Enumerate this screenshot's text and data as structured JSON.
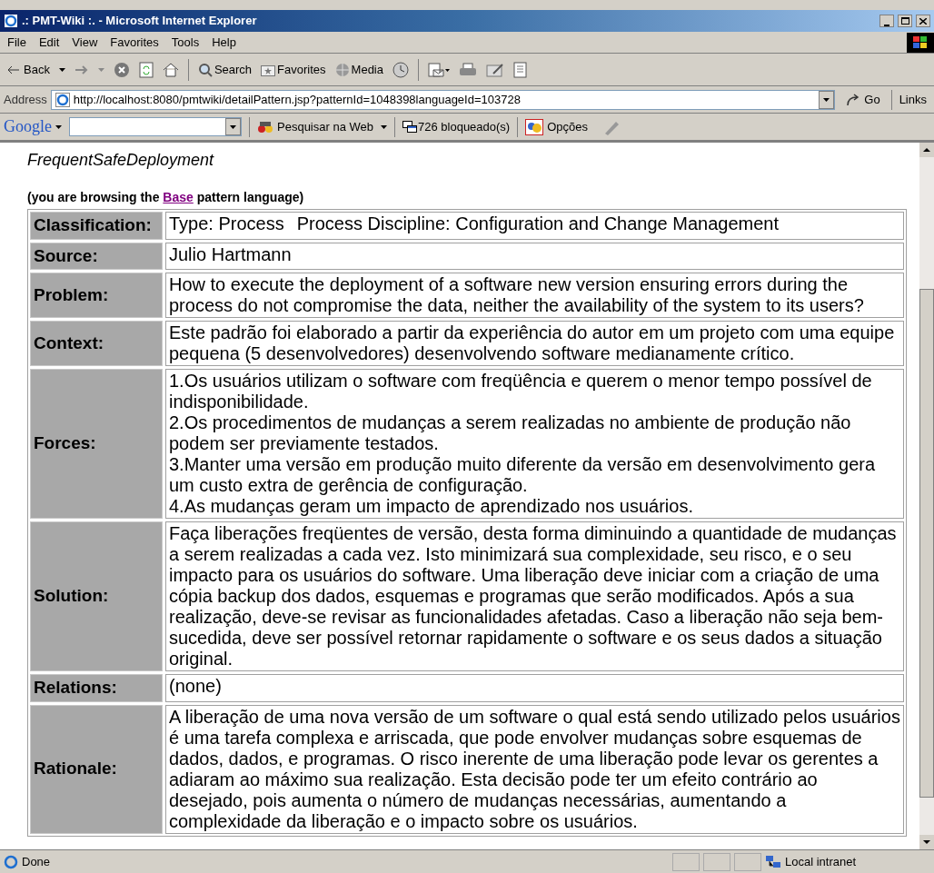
{
  "window": {
    "title": ".: PMT-Wiki :. - Microsoft Internet Explorer"
  },
  "menu": [
    "File",
    "Edit",
    "View",
    "Favorites",
    "Tools",
    "Help"
  ],
  "toolbar": {
    "back": "Back",
    "search": "Search",
    "favorites": "Favorites",
    "media": "Media"
  },
  "address_bar": {
    "label": "Address",
    "url": "http://localhost:8080/pmtwiki/detailPattern.jsp?patternId=1048398languageId=103728",
    "go": "Go",
    "links": "Links"
  },
  "google_bar": {
    "logo": "Google",
    "search_web": "Pesquisar na Web",
    "blocked": "726 bloqueado(s)",
    "options": "Opções"
  },
  "page": {
    "title": "FrequentSafeDeployment",
    "note": {
      "before": "(you are browsing the ",
      "link": "Base",
      "after": " pattern language)"
    },
    "rows": [
      {
        "label": "Classification:",
        "parts": [
          "Type: Process",
          "Process Discipline: Configuration and Change Management"
        ]
      },
      {
        "label": "Source:",
        "parts": [
          "Julio Hartmann"
        ]
      },
      {
        "label": "Problem:",
        "paragraphs": [
          "How to execute the deployment of a software new version ensuring errors during the process do not compromise the data, neither the availability of the system to its users?"
        ]
      },
      {
        "label": "Context:",
        "paragraphs": [
          "Este padrão foi elaborado a partir da experiência do autor em um projeto com uma equipe pequena (5 desenvolvedores) desenvolvendo software medianamente crítico."
        ]
      },
      {
        "label": "Forces:",
        "paragraphs": [
          "1.Os usuários utilizam o software com freqüência e querem o menor tempo possível de indisponibilidade.",
          "2.Os procedimentos de mudanças a serem realizadas no ambiente de produção não podem ser previamente testados.",
          "3.Manter uma versão em produção muito diferente da versão em desenvolvimento gera um custo extra de gerência de configuração.",
          "4.As mudanças geram um impacto de aprendizado nos usuários."
        ]
      },
      {
        "label": "Solution:",
        "paragraphs": [
          "Faça liberações freqüentes de versão, desta forma diminuindo a quantidade de mudanças a serem realizadas a cada vez. Isto minimizará sua complexidade, seu risco, e o seu impacto para os usuários do software. Uma liberação deve iniciar com a criação de uma cópia backup dos dados, esquemas e programas que serão modificados. Após a sua realização, deve-se revisar as funcionalidades afetadas. Caso a liberação não seja bem-sucedida, deve ser possível retornar rapidamente o software e os seus dados a situação original."
        ]
      },
      {
        "label": "Relations:",
        "parts": [
          "(none)"
        ]
      },
      {
        "label": "Rationale:",
        "paragraphs": [
          "A liberação de uma nova versão de um software o qual está sendo utilizado pelos usuários é uma tarefa complexa e arriscada, que pode envolver mudanças sobre esquemas de dados, dados, e programas. O risco inerente de uma liberação pode levar os gerentes a adiaram ao máximo sua realização. Esta decisão pode ter um efeito contrário ao desejado, pois aumenta o número de mudanças necessárias, aumentando a complexidade da liberação e o impacto sobre os usuários."
        ]
      }
    ]
  },
  "status_bar": {
    "text": "Done",
    "zone": "Local intranet"
  }
}
